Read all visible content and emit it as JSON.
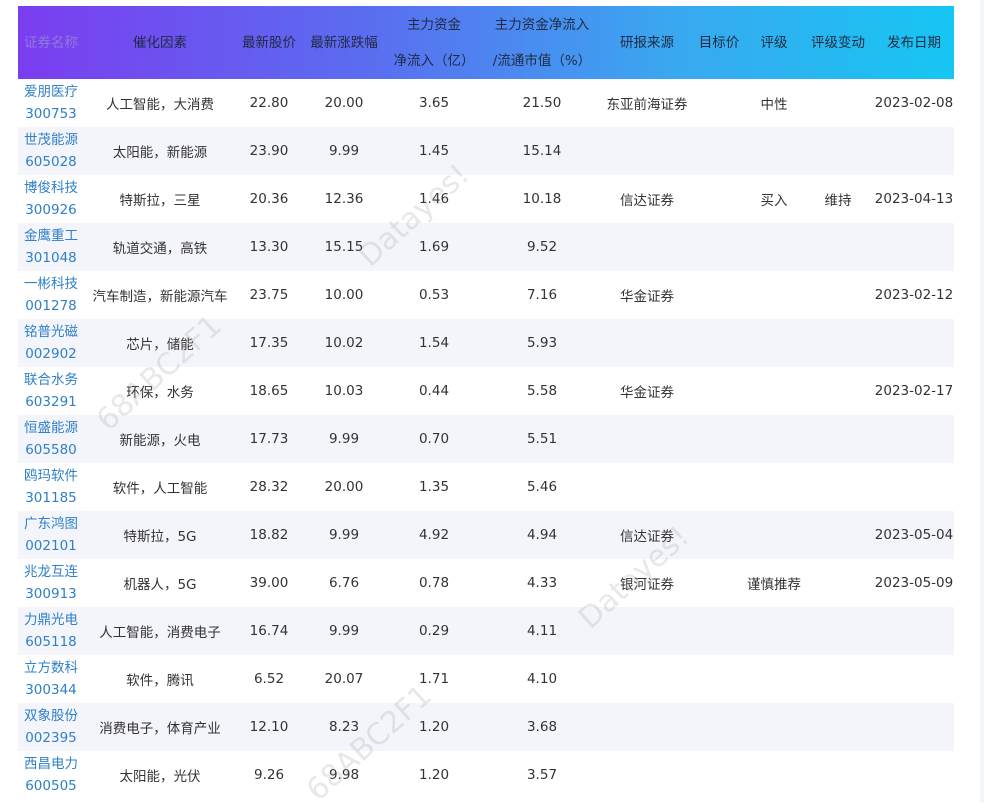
{
  "table": {
    "headers": [
      {
        "lines": [
          "证券名称"
        ]
      },
      {
        "lines": [
          "催化因素"
        ]
      },
      {
        "lines": [
          "最新股价"
        ]
      },
      {
        "lines": [
          "最新涨跌幅"
        ]
      },
      {
        "lines": [
          "主力资金",
          "净流入（亿）"
        ]
      },
      {
        "lines": [
          "主力资金净流入",
          "/流通市值（%）"
        ]
      },
      {
        "lines": [
          "研报来源"
        ]
      },
      {
        "lines": [
          "目标价"
        ]
      },
      {
        "lines": [
          "评级"
        ]
      },
      {
        "lines": [
          "评级变动"
        ]
      },
      {
        "lines": [
          "发布日期"
        ]
      }
    ],
    "rows": [
      {
        "name": "爱朋医疗",
        "code": "300753",
        "factor": "人工智能，大消费",
        "price": "22.80",
        "change": "20.00",
        "inflow": "3.65",
        "ratio": "21.50",
        "source": "东亚前海证券",
        "target": "",
        "rating": "中性",
        "rating_change": "",
        "date": "2023-02-08"
      },
      {
        "name": "世茂能源",
        "code": "605028",
        "factor": "太阳能，新能源",
        "price": "23.90",
        "change": "9.99",
        "inflow": "1.45",
        "ratio": "15.14",
        "source": "",
        "target": "",
        "rating": "",
        "rating_change": "",
        "date": ""
      },
      {
        "name": "博俊科技",
        "code": "300926",
        "factor": "特斯拉，三星",
        "price": "20.36",
        "change": "12.36",
        "inflow": "1.46",
        "ratio": "10.18",
        "source": "信达证券",
        "target": "",
        "rating": "买入",
        "rating_change": "维持",
        "date": "2023-04-13"
      },
      {
        "name": "金鹰重工",
        "code": "301048",
        "factor": "轨道交通，高铁",
        "price": "13.30",
        "change": "15.15",
        "inflow": "1.69",
        "ratio": "9.52",
        "source": "",
        "target": "",
        "rating": "",
        "rating_change": "",
        "date": ""
      },
      {
        "name": "一彬科技",
        "code": "001278",
        "factor": "汽车制造，新能源汽车",
        "price": "23.75",
        "change": "10.00",
        "inflow": "0.53",
        "ratio": "7.16",
        "source": "华金证券",
        "target": "",
        "rating": "",
        "rating_change": "",
        "date": "2023-02-12"
      },
      {
        "name": "铭普光磁",
        "code": "002902",
        "factor": "芯片，储能",
        "price": "17.35",
        "change": "10.02",
        "inflow": "1.54",
        "ratio": "5.93",
        "source": "",
        "target": "",
        "rating": "",
        "rating_change": "",
        "date": ""
      },
      {
        "name": "联合水务",
        "code": "603291",
        "factor": "环保，水务",
        "price": "18.65",
        "change": "10.03",
        "inflow": "0.44",
        "ratio": "5.58",
        "source": "华金证券",
        "target": "",
        "rating": "",
        "rating_change": "",
        "date": "2023-02-17"
      },
      {
        "name": "恒盛能源",
        "code": "605580",
        "factor": "新能源，火电",
        "price": "17.73",
        "change": "9.99",
        "inflow": "0.70",
        "ratio": "5.51",
        "source": "",
        "target": "",
        "rating": "",
        "rating_change": "",
        "date": ""
      },
      {
        "name": "鸥玛软件",
        "code": "301185",
        "factor": "软件，人工智能",
        "price": "28.32",
        "change": "20.00",
        "inflow": "1.35",
        "ratio": "5.46",
        "source": "",
        "target": "",
        "rating": "",
        "rating_change": "",
        "date": ""
      },
      {
        "name": "广东鸿图",
        "code": "002101",
        "factor": "特斯拉，5G",
        "price": "18.82",
        "change": "9.99",
        "inflow": "4.92",
        "ratio": "4.94",
        "source": "信达证券",
        "target": "",
        "rating": "",
        "rating_change": "",
        "date": "2023-05-04"
      },
      {
        "name": "兆龙互连",
        "code": "300913",
        "factor": "机器人，5G",
        "price": "39.00",
        "change": "6.76",
        "inflow": "0.78",
        "ratio": "4.33",
        "source": "银河证券",
        "target": "",
        "rating": "谨慎推荐",
        "rating_change": "",
        "date": "2023-05-09"
      },
      {
        "name": "力鼎光电",
        "code": "605118",
        "factor": "人工智能，消费电子",
        "price": "16.74",
        "change": "9.99",
        "inflow": "0.29",
        "ratio": "4.11",
        "source": "",
        "target": "",
        "rating": "",
        "rating_change": "",
        "date": ""
      },
      {
        "name": "立方数科",
        "code": "300344",
        "factor": "软件，腾讯",
        "price": "6.52",
        "change": "20.07",
        "inflow": "1.71",
        "ratio": "4.10",
        "source": "",
        "target": "",
        "rating": "",
        "rating_change": "",
        "date": ""
      },
      {
        "name": "双象股份",
        "code": "002395",
        "factor": "消费电子，体育产业",
        "price": "12.10",
        "change": "8.23",
        "inflow": "1.20",
        "ratio": "3.68",
        "source": "",
        "target": "",
        "rating": "",
        "rating_change": "",
        "date": ""
      },
      {
        "name": "西昌电力",
        "code": "600505",
        "factor": "太阳能，光伏",
        "price": "9.26",
        "change": "9.98",
        "inflow": "1.20",
        "ratio": "3.57",
        "source": "",
        "target": "",
        "rating": "",
        "rating_change": "",
        "date": ""
      }
    ]
  },
  "watermarks": [
    "Datayes!",
    "68ABC2F1",
    "Datayes!",
    "68ABC2F1"
  ]
}
